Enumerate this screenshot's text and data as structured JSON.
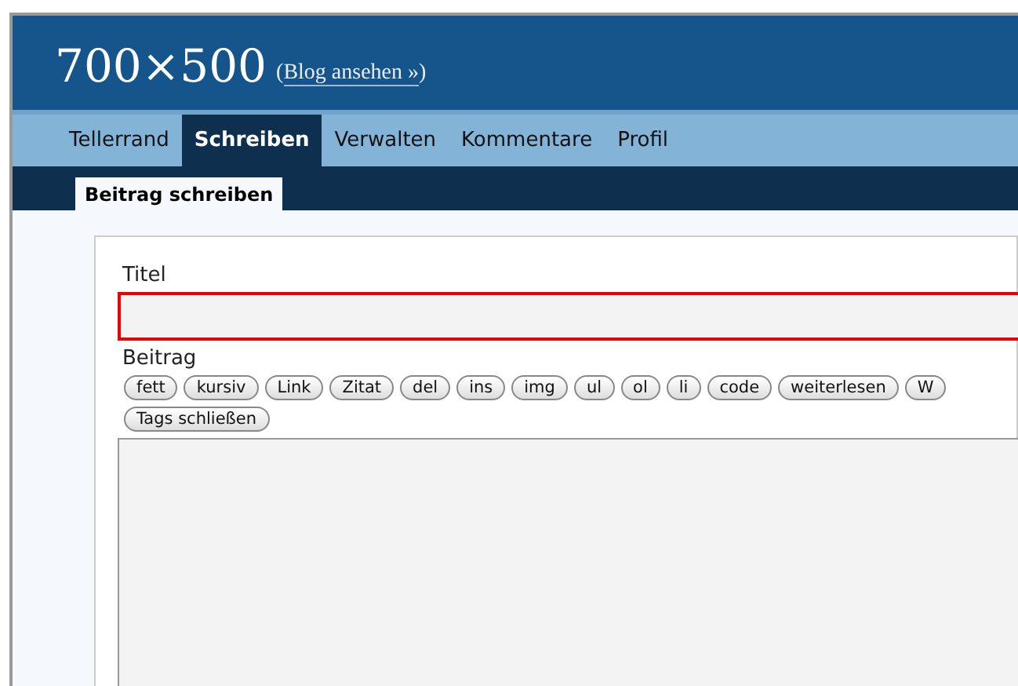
{
  "header": {
    "site_title": "700×500",
    "open_paren": "(",
    "view_link": "Blog ansehen »",
    "close_paren": ")"
  },
  "nav": [
    {
      "label": "Tellerrand",
      "selected": false
    },
    {
      "label": "Schreiben",
      "selected": true
    },
    {
      "label": "Verwalten",
      "selected": false
    },
    {
      "label": "Kommentare",
      "selected": false
    },
    {
      "label": "Profil",
      "selected": false
    }
  ],
  "subnav": [
    {
      "label": "Beitrag schreiben",
      "selected": true
    }
  ],
  "form": {
    "title_label": "Titel",
    "title_invalid": true,
    "body_label": "Beitrag",
    "toolbar": [
      "fett",
      "kursiv",
      "Link",
      "Zitat",
      "del",
      "ins",
      "img",
      "ul",
      "ol",
      "li",
      "code",
      "weiterlesen",
      "W"
    ],
    "close_tags": "Tags schließen"
  }
}
